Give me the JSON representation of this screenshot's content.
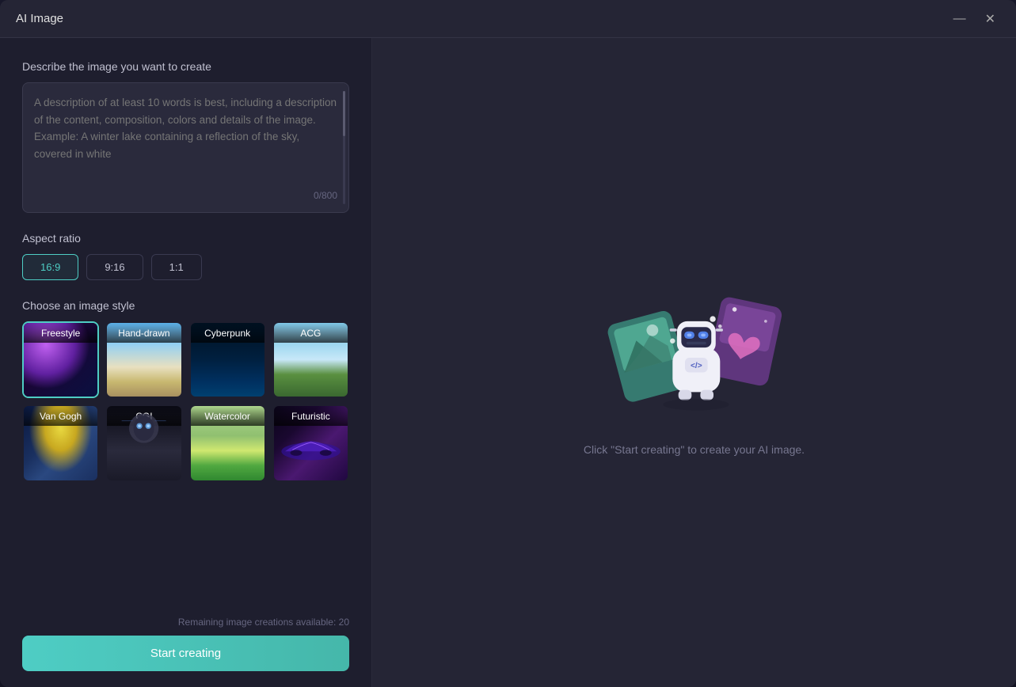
{
  "window": {
    "title": "AI Image"
  },
  "titlebar": {
    "minimize_label": "—",
    "close_label": "✕"
  },
  "left_panel": {
    "description_label": "Describe the image you want to create",
    "description_placeholder": "A description of at least 10 words is best, including a description of the content, composition, colors and details of the image. Example: A winter lake containing a reflection of the sky, covered in white",
    "char_count": "0/800",
    "aspect_ratio_label": "Aspect ratio",
    "aspect_ratios": [
      {
        "value": "16:9",
        "active": true
      },
      {
        "value": "9:16",
        "active": false
      },
      {
        "value": "1:1",
        "active": false
      }
    ],
    "style_label": "Choose an image style",
    "styles": [
      {
        "id": "freestyle",
        "name": "Freestyle",
        "selected": true
      },
      {
        "id": "handdrawn",
        "name": "Hand-drawn",
        "selected": false
      },
      {
        "id": "cyberpunk",
        "name": "Cyberpunk",
        "selected": false
      },
      {
        "id": "acg",
        "name": "ACG",
        "selected": false
      },
      {
        "id": "vangogh",
        "name": "Van Gogh",
        "selected": false
      },
      {
        "id": "cgi",
        "name": "CGI",
        "selected": false
      },
      {
        "id": "watercolor",
        "name": "Watercolor",
        "selected": false
      },
      {
        "id": "futuristic",
        "name": "Futuristic",
        "selected": false
      }
    ],
    "remaining_text": "Remaining image creations available: 20",
    "start_button_label": "Start creating"
  },
  "right_panel": {
    "hint_text": "Click \"Start creating\" to create your AI image."
  }
}
